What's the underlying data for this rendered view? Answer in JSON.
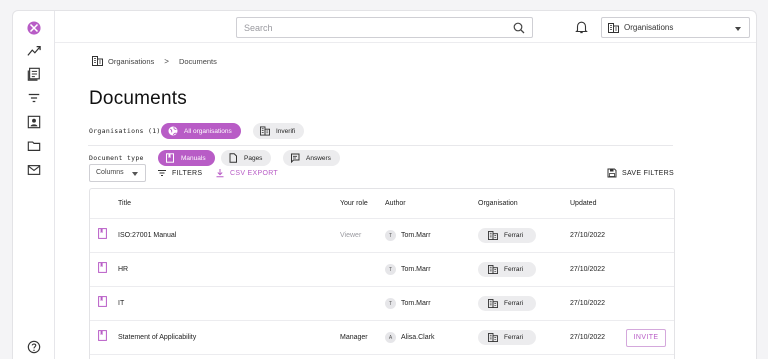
{
  "colors": {
    "accent": "#b85cc6",
    "chip_bg": "#ececee",
    "border": "#e3e3e6"
  },
  "sidebar": {
    "icons": [
      "logo-icon",
      "trend-icon",
      "news-icon",
      "filter-icon",
      "account-box-icon",
      "folder-icon",
      "mail-icon",
      "help-icon"
    ]
  },
  "topbar": {
    "search_placeholder": "Search",
    "org_select_value": "Organisations"
  },
  "breadcrumb": {
    "root": "Organisations",
    "separator": ">",
    "current": "Documents"
  },
  "page_title": "Documents",
  "filters": {
    "organisations_label": "Organisations (1)",
    "org_chips": [
      {
        "label": "All organisations",
        "active": true,
        "icon": "globe-icon"
      },
      {
        "label": "Inverifi",
        "active": false,
        "icon": "building-icon"
      }
    ],
    "doc_type_label": "Document type",
    "type_chips": [
      {
        "label": "Manuals",
        "active": true,
        "icon": "book-icon"
      },
      {
        "label": "Pages",
        "active": false,
        "icon": "page-icon"
      },
      {
        "label": "Answers",
        "active": false,
        "icon": "answer-icon"
      }
    ]
  },
  "toolbar": {
    "columns_label": "Columns",
    "filters_label": "FILTERS",
    "csv_label": "CSV EXPORT",
    "save_filters_label": "SAVE FILTERS"
  },
  "table": {
    "headers": {
      "title": "Title",
      "role": "Your role",
      "author": "Author",
      "organisation": "Organisation",
      "updated": "Updated"
    },
    "rows": [
      {
        "title": "ISO:27001 Manual",
        "role": "Viewer",
        "author_initial": "T",
        "author": "Tom.Marr",
        "organisation": "Ferrari",
        "updated": "27/10/2022",
        "action": ""
      },
      {
        "title": "HR",
        "role": "",
        "author_initial": "T",
        "author": "Tom.Marr",
        "organisation": "Ferrari",
        "updated": "27/10/2022",
        "action": ""
      },
      {
        "title": "IT",
        "role": "",
        "author_initial": "T",
        "author": "Tom.Marr",
        "organisation": "Ferrari",
        "updated": "27/10/2022",
        "action": ""
      },
      {
        "title": "Statement of Applicability",
        "role": "Manager",
        "author_initial": "A",
        "author": "Alisa.Clark",
        "organisation": "Ferrari",
        "updated": "27/10/2022",
        "action": "INVITE"
      }
    ]
  }
}
